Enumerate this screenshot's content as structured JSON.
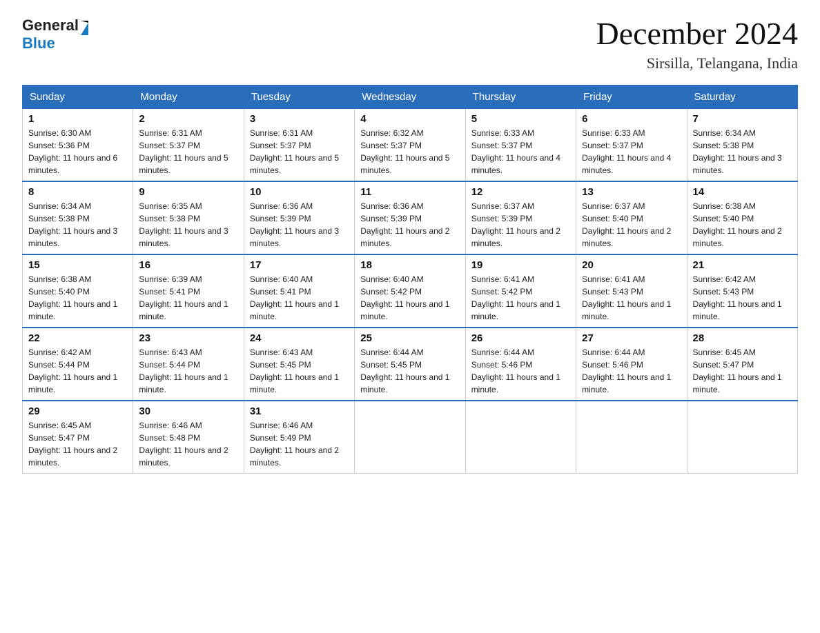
{
  "logo": {
    "text_general": "General",
    "text_blue": "Blue"
  },
  "title": "December 2024",
  "subtitle": "Sirsilla, Telangana, India",
  "weekdays": [
    "Sunday",
    "Monday",
    "Tuesday",
    "Wednesday",
    "Thursday",
    "Friday",
    "Saturday"
  ],
  "weeks": [
    [
      {
        "day": "1",
        "sunrise": "6:30 AM",
        "sunset": "5:36 PM",
        "daylight": "11 hours and 6 minutes."
      },
      {
        "day": "2",
        "sunrise": "6:31 AM",
        "sunset": "5:37 PM",
        "daylight": "11 hours and 5 minutes."
      },
      {
        "day": "3",
        "sunrise": "6:31 AM",
        "sunset": "5:37 PM",
        "daylight": "11 hours and 5 minutes."
      },
      {
        "day": "4",
        "sunrise": "6:32 AM",
        "sunset": "5:37 PM",
        "daylight": "11 hours and 5 minutes."
      },
      {
        "day": "5",
        "sunrise": "6:33 AM",
        "sunset": "5:37 PM",
        "daylight": "11 hours and 4 minutes."
      },
      {
        "day": "6",
        "sunrise": "6:33 AM",
        "sunset": "5:37 PM",
        "daylight": "11 hours and 4 minutes."
      },
      {
        "day": "7",
        "sunrise": "6:34 AM",
        "sunset": "5:38 PM",
        "daylight": "11 hours and 3 minutes."
      }
    ],
    [
      {
        "day": "8",
        "sunrise": "6:34 AM",
        "sunset": "5:38 PM",
        "daylight": "11 hours and 3 minutes."
      },
      {
        "day": "9",
        "sunrise": "6:35 AM",
        "sunset": "5:38 PM",
        "daylight": "11 hours and 3 minutes."
      },
      {
        "day": "10",
        "sunrise": "6:36 AM",
        "sunset": "5:39 PM",
        "daylight": "11 hours and 3 minutes."
      },
      {
        "day": "11",
        "sunrise": "6:36 AM",
        "sunset": "5:39 PM",
        "daylight": "11 hours and 2 minutes."
      },
      {
        "day": "12",
        "sunrise": "6:37 AM",
        "sunset": "5:39 PM",
        "daylight": "11 hours and 2 minutes."
      },
      {
        "day": "13",
        "sunrise": "6:37 AM",
        "sunset": "5:40 PM",
        "daylight": "11 hours and 2 minutes."
      },
      {
        "day": "14",
        "sunrise": "6:38 AM",
        "sunset": "5:40 PM",
        "daylight": "11 hours and 2 minutes."
      }
    ],
    [
      {
        "day": "15",
        "sunrise": "6:38 AM",
        "sunset": "5:40 PM",
        "daylight": "11 hours and 1 minute."
      },
      {
        "day": "16",
        "sunrise": "6:39 AM",
        "sunset": "5:41 PM",
        "daylight": "11 hours and 1 minute."
      },
      {
        "day": "17",
        "sunrise": "6:40 AM",
        "sunset": "5:41 PM",
        "daylight": "11 hours and 1 minute."
      },
      {
        "day": "18",
        "sunrise": "6:40 AM",
        "sunset": "5:42 PM",
        "daylight": "11 hours and 1 minute."
      },
      {
        "day": "19",
        "sunrise": "6:41 AM",
        "sunset": "5:42 PM",
        "daylight": "11 hours and 1 minute."
      },
      {
        "day": "20",
        "sunrise": "6:41 AM",
        "sunset": "5:43 PM",
        "daylight": "11 hours and 1 minute."
      },
      {
        "day": "21",
        "sunrise": "6:42 AM",
        "sunset": "5:43 PM",
        "daylight": "11 hours and 1 minute."
      }
    ],
    [
      {
        "day": "22",
        "sunrise": "6:42 AM",
        "sunset": "5:44 PM",
        "daylight": "11 hours and 1 minute."
      },
      {
        "day": "23",
        "sunrise": "6:43 AM",
        "sunset": "5:44 PM",
        "daylight": "11 hours and 1 minute."
      },
      {
        "day": "24",
        "sunrise": "6:43 AM",
        "sunset": "5:45 PM",
        "daylight": "11 hours and 1 minute."
      },
      {
        "day": "25",
        "sunrise": "6:44 AM",
        "sunset": "5:45 PM",
        "daylight": "11 hours and 1 minute."
      },
      {
        "day": "26",
        "sunrise": "6:44 AM",
        "sunset": "5:46 PM",
        "daylight": "11 hours and 1 minute."
      },
      {
        "day": "27",
        "sunrise": "6:44 AM",
        "sunset": "5:46 PM",
        "daylight": "11 hours and 1 minute."
      },
      {
        "day": "28",
        "sunrise": "6:45 AM",
        "sunset": "5:47 PM",
        "daylight": "11 hours and 1 minute."
      }
    ],
    [
      {
        "day": "29",
        "sunrise": "6:45 AM",
        "sunset": "5:47 PM",
        "daylight": "11 hours and 2 minutes."
      },
      {
        "day": "30",
        "sunrise": "6:46 AM",
        "sunset": "5:48 PM",
        "daylight": "11 hours and 2 minutes."
      },
      {
        "day": "31",
        "sunrise": "6:46 AM",
        "sunset": "5:49 PM",
        "daylight": "11 hours and 2 minutes."
      },
      null,
      null,
      null,
      null
    ]
  ],
  "labels": {
    "sunrise": "Sunrise:",
    "sunset": "Sunset:",
    "daylight": "Daylight:"
  }
}
